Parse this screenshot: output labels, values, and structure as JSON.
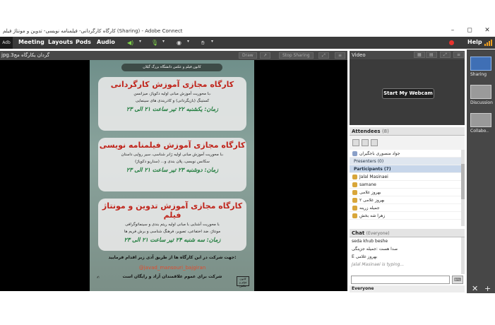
{
  "window": {
    "title": "کارگاه کارگردانی- فیلمنامه نویسی- تدوین و مونتاژ فیلم (Sharing) - Adobe Connect",
    "minimize": "–",
    "maximize": "◻",
    "close": "✕"
  },
  "menubar": {
    "logo": "Adb",
    "items": [
      "Meeting",
      "Layouts",
      "Pods",
      "Audio"
    ],
    "help": "Help"
  },
  "share": {
    "file_name": "jpg.گردان یکارگاه مج3",
    "draw_label": "Draw",
    "stop_label": "Stop Sharing"
  },
  "poster": {
    "ribbon": "کانون فیلم و عکس دانشگاه بزرگ گیلان",
    "cards": [
      {
        "title": "کارگاه مجازی آموزش کارگردانی",
        "line1": "با محوریت آموزش مبانی اولیه دکوپاژ، میزانسن،",
        "line2": "کستینگ (بازیگردانی) و کادربندی های سینمایی",
        "date": "زمان: یکشنبه ۲۲ تیر ساعت ۲۱ الی ۲۳"
      },
      {
        "title": "کارگاه مجازی آموزش فیلمنامه نویسی",
        "line1": "با محوریت آموزش مبانی اولیه ژانر شناسی، سیر روایی داستان،",
        "line2": "سکانس نویسی، پلان بندی و... (سناریو دکوپاژ)",
        "date": "زمان: دوشنبه ۲۳ تیر ساعت ۲۱ الی ۲۳"
      },
      {
        "title": "کارگاه مجازی آموزش تدوین و مونتاژ فیلم",
        "line1": "با محوریت آشنایی با مبانی اولیه ریتم بندی و سینماتوگرافی",
        "line2": "مونتاژ، ضد اختفاعی، تصویر، فرهنگ شناسی و برش فریم ها",
        "date": "زمان: سه شنبه ۲۴ تیر ساعت ۲۱ الی ۲۳"
      }
    ],
    "join_text": "جهت شرکت در این کارگاه ها از طریق آدی زیر اقدام فرمایید:",
    "handle": "@javad_mansouri_bajgiran",
    "free_text": "شرکت برای عموم علاقمندان آزاد و رایگان است",
    "emblem": "کانون فیلم و عکس"
  },
  "video": {
    "title": "Video",
    "webcam_label": "Start My Webcam"
  },
  "attendees": {
    "title": "Attendees",
    "count": "(8)",
    "host": "جواد منصوری باجگیران",
    "presenters": "Presenters (0)",
    "participants": "Participants (7)",
    "names": [
      "Jalal Masinaei",
      "samane",
      "بهروز غلامی",
      "بهروز غلامی ۲",
      "جمیله زرینه",
      "زهرا شه بخش"
    ]
  },
  "chat": {
    "title": "Chat",
    "scope": "(Everyone)",
    "messages": [
      "seda khub beshe",
      "صدا هست :جمیله جزینگی",
      "E بهروز غلامی",
      "Jalal Masinaei is typing..."
    ],
    "send_icon": "⌨",
    "target": "Everyone"
  },
  "rail": {
    "items": [
      "Sharing",
      "Discussion",
      "Collabo.."
    ],
    "ctl_left": "✕",
    "ctl_right": "+"
  },
  "colors": {
    "menubar": "#3a3a3a",
    "poster_title": "#c0241b",
    "poster_date": "#1c7a3a",
    "record": "#e8322d",
    "active_layout": "#3f6fb5"
  }
}
